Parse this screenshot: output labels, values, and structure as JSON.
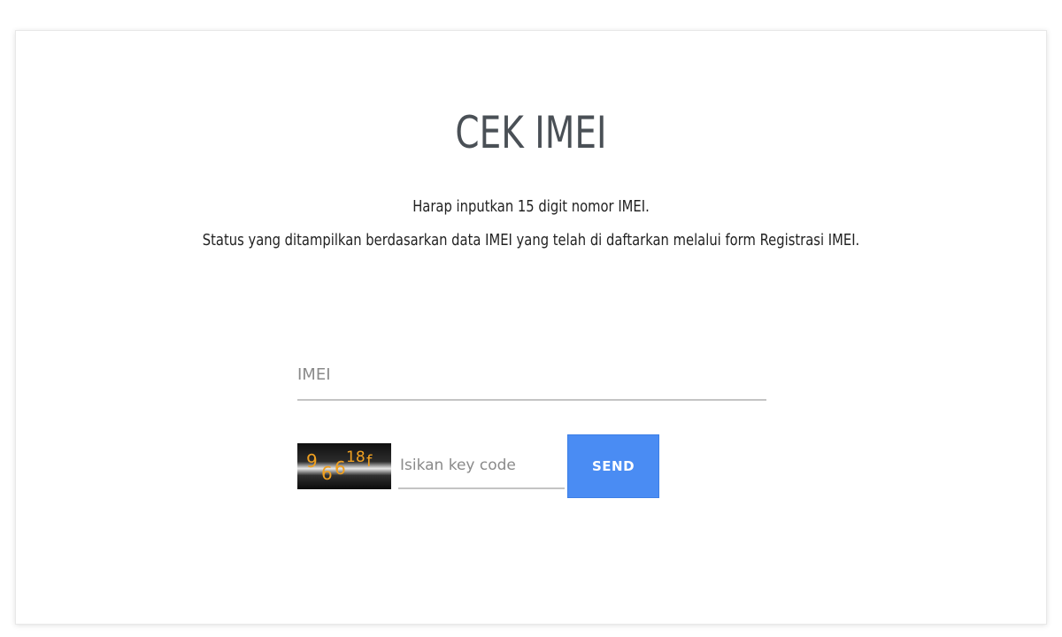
{
  "page": {
    "title": "CEK IMEI",
    "description_line1": "Harap inputkan 15 digit nomor IMEI.",
    "description_line2": "Status yang ditampilkan berdasarkan data IMEI yang telah di daftarkan melalui form Registrasi IMEI."
  },
  "form": {
    "imei_placeholder": "IMEI",
    "imei_value": "",
    "captcha_chars": [
      "9",
      "6",
      "6",
      "18",
      "f"
    ],
    "key_placeholder": "Isikan key code",
    "key_value": "",
    "send_label": "SEND"
  },
  "colors": {
    "accent": "#4a8cf3",
    "captcha_text": "#f0a020"
  }
}
